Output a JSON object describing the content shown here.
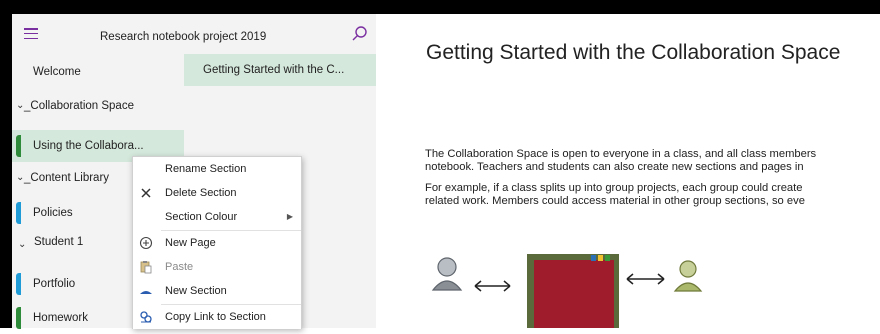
{
  "notebook": {
    "title": "Research notebook project 2019"
  },
  "sections": [
    {
      "label": "Welcome",
      "type": "section",
      "selected": false
    },
    {
      "label": "_Collaboration Space",
      "type": "group",
      "expanded": true
    },
    {
      "label": "Using the Collabora...",
      "type": "section",
      "selected": true,
      "color": "#2e8b3a"
    },
    {
      "label": "_Content Library",
      "type": "group",
      "expanded": true
    },
    {
      "label": "Policies",
      "type": "section",
      "selected": false,
      "color": "#1f9bd7"
    },
    {
      "label": "Student 1",
      "type": "group",
      "expanded": true
    },
    {
      "label": "Portfolio",
      "type": "section",
      "selected": false,
      "color": "#1f9bd7"
    },
    {
      "label": "Homework",
      "type": "section",
      "selected": false,
      "color": "#2e8b3a"
    }
  ],
  "pages": [
    {
      "label": "Getting Started with the C...",
      "selected": true
    }
  ],
  "content": {
    "title": "Getting Started with the Collaboration Space",
    "paragraphs": [
      "The Collaboration Space is open to everyone in a class, and all class members",
      "notebook.  Teachers and students can also create new sections and pages in",
      "For example, if a class splits up into group projects, each group could create",
      "related work. Members could access material in other group sections, so eve"
    ]
  },
  "context_menu": {
    "items": [
      {
        "label": "Rename Section",
        "icon": "none",
        "disabled": false
      },
      {
        "label": "Delete Section",
        "icon": "close-icon",
        "disabled": false
      },
      {
        "label": "Section Colour",
        "icon": "none",
        "disabled": false,
        "submenu": true
      },
      {
        "label": "New Page",
        "icon": "plus-circle-icon",
        "disabled": false
      },
      {
        "label": "Paste",
        "icon": "paste-icon",
        "disabled": true
      },
      {
        "label": "New Section",
        "icon": "section-tab-icon",
        "disabled": false
      },
      {
        "label": "Copy Link to Section",
        "icon": "link-icon",
        "disabled": false
      }
    ]
  },
  "colors": {
    "accent": "#7a2fa0",
    "selected": "#d5e8dc",
    "green": "#2e8b3a",
    "blue": "#1f9bd7",
    "user_grey": "#8a8f96",
    "user_green": "#a9b86a"
  }
}
